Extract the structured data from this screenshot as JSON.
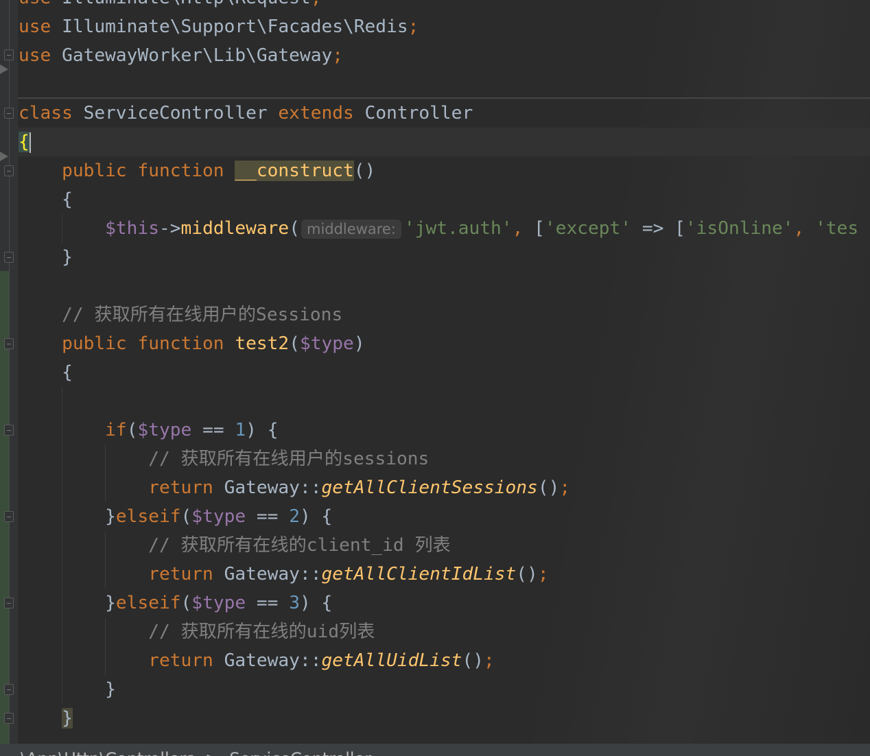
{
  "colors": {
    "keyword": "#cc7832",
    "identifier": "#a9b7c6",
    "variable": "#9876aa",
    "function": "#ffc66d",
    "string": "#6a8759",
    "comment": "#808080",
    "number": "#6897bb"
  },
  "code": [
    [
      [
        "use ",
        "kw"
      ],
      [
        "Illuminate\\Http\\Request",
        "id"
      ],
      [
        ";",
        "kw"
      ]
    ],
    [
      [
        "use ",
        "kw"
      ],
      [
        "Illuminate\\Support\\Facades\\Redis",
        "id"
      ],
      [
        ";",
        "kw"
      ]
    ],
    [
      [
        "use ",
        "kw"
      ],
      [
        "GatewayWorker\\Lib\\Gateway",
        "id"
      ],
      [
        ";",
        "kw"
      ]
    ],
    [],
    [
      [
        "class ",
        "kw"
      ],
      [
        "ServiceController ",
        "id"
      ],
      [
        "extends ",
        "kw"
      ],
      [
        "Controller",
        "id"
      ]
    ],
    [
      [
        "{",
        "brace"
      ],
      [
        "",
        "caret"
      ]
    ],
    [
      [
        "    ",
        "id"
      ],
      [
        "public function ",
        "kw"
      ],
      [
        "__construct",
        "fn hl"
      ],
      [
        "()",
        "id"
      ]
    ],
    [
      [
        "    {",
        "id"
      ]
    ],
    [
      [
        "        ",
        "id"
      ],
      [
        "$this",
        "var"
      ],
      [
        "->",
        "id"
      ],
      [
        "middleware",
        "fn"
      ],
      [
        "(",
        "id"
      ],
      [
        "middleware:",
        "hint"
      ],
      [
        "'jwt.auth'",
        "str"
      ],
      [
        ", ",
        "kw"
      ],
      [
        "[",
        "id"
      ],
      [
        "'except'",
        "str"
      ],
      [
        " => [",
        "id"
      ],
      [
        "'isOnline'",
        "str"
      ],
      [
        ", ",
        "kw"
      ],
      [
        "'tes",
        "str"
      ]
    ],
    [
      [
        "    }",
        "id"
      ]
    ],
    [],
    [
      [
        "    // 获取所有在线用户的Sessions",
        "cm"
      ]
    ],
    [
      [
        "    ",
        "id"
      ],
      [
        "public function ",
        "kw"
      ],
      [
        "test2",
        "fn"
      ],
      [
        "(",
        "id"
      ],
      [
        "$type",
        "var"
      ],
      [
        ")",
        "id"
      ]
    ],
    [
      [
        "    {",
        "id"
      ]
    ],
    [],
    [
      [
        "        ",
        "id"
      ],
      [
        "if",
        "kw"
      ],
      [
        "(",
        "id"
      ],
      [
        "$type",
        "var"
      ],
      [
        " == ",
        "id"
      ],
      [
        "1",
        "num"
      ],
      [
        ") {",
        "id"
      ]
    ],
    [
      [
        "            // 获取所有在线用户的sessions",
        "cm"
      ]
    ],
    [
      [
        "            ",
        "id"
      ],
      [
        "return ",
        "kw"
      ],
      [
        "Gateway::",
        "id"
      ],
      [
        "getAllClientSessions",
        "fni"
      ],
      [
        "()",
        "id"
      ],
      [
        ";",
        "kw"
      ]
    ],
    [
      [
        "        }",
        "id"
      ],
      [
        "elseif",
        "kw"
      ],
      [
        "(",
        "id"
      ],
      [
        "$type",
        "var"
      ],
      [
        " == ",
        "id"
      ],
      [
        "2",
        "num"
      ],
      [
        ") {",
        "id"
      ]
    ],
    [
      [
        "            // 获取所有在线的client_id 列表",
        "cm"
      ]
    ],
    [
      [
        "            ",
        "id"
      ],
      [
        "return ",
        "kw"
      ],
      [
        "Gateway::",
        "id"
      ],
      [
        "getAllClientIdList",
        "fni"
      ],
      [
        "()",
        "id"
      ],
      [
        ";",
        "kw"
      ]
    ],
    [
      [
        "        }",
        "id"
      ],
      [
        "elseif",
        "kw"
      ],
      [
        "(",
        "id"
      ],
      [
        "$type",
        "var"
      ],
      [
        " == ",
        "id"
      ],
      [
        "3",
        "num"
      ],
      [
        ") {",
        "id"
      ]
    ],
    [
      [
        "            // 获取所有在线的uid列表",
        "cm"
      ]
    ],
    [
      [
        "            ",
        "id"
      ],
      [
        "return ",
        "kw"
      ],
      [
        "Gateway::",
        "id"
      ],
      [
        "getAllUidList",
        "fni"
      ],
      [
        "()",
        "id"
      ],
      [
        ";",
        "kw"
      ]
    ],
    [
      [
        "        }",
        "id"
      ]
    ],
    [
      [
        "    ",
        "id"
      ],
      [
        "}",
        "id mb"
      ]
    ]
  ],
  "status": {
    "breadcrumb": "\\App\\Http\\Controllers  >  ServiceController"
  }
}
